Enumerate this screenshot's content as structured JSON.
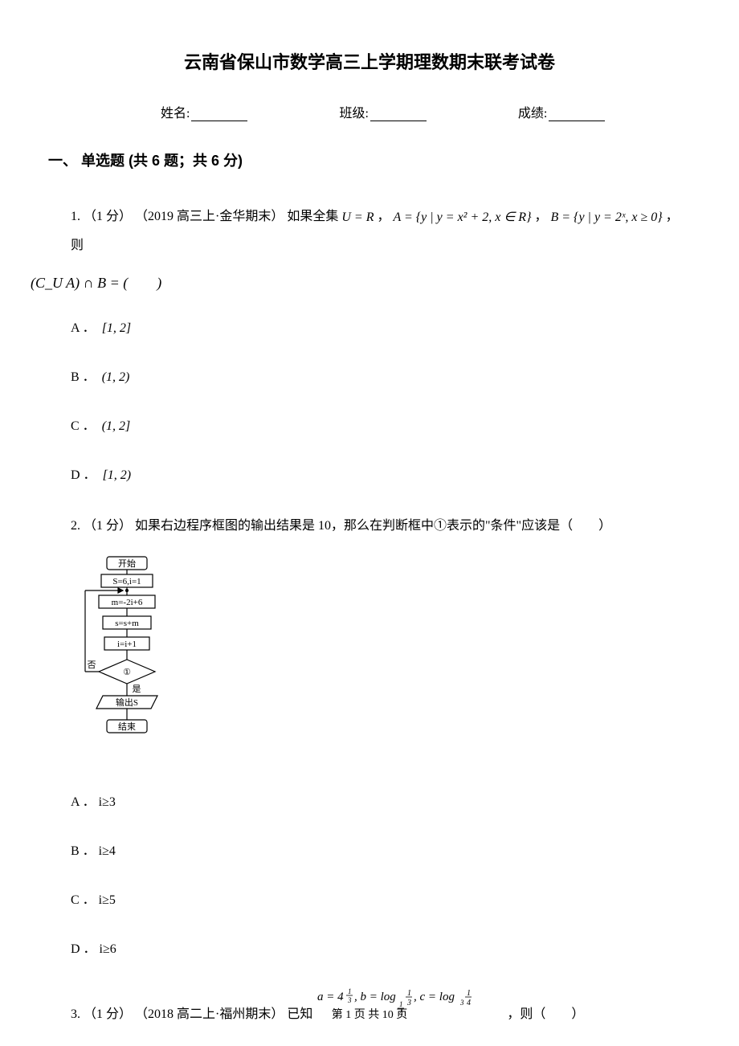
{
  "title": "云南省保山市数学高三上学期理数期末联考试卷",
  "header": {
    "name_label": "姓名:",
    "class_label": "班级:",
    "score_label": "成绩:"
  },
  "section1": {
    "heading": "一、 单选题 (共 6 题；共 6 分)"
  },
  "q1": {
    "stem_prefix": "1. （1 分） （2019 高三上·金华期末） 如果全集 ",
    "math1": "U = R",
    "sep1": " ， ",
    "math2": "A = {y | y = x² + 2, x ∈ R}",
    "sep2": " ， ",
    "math3": "B = {y | y = 2ˣ, x ≥ 0}",
    "sep3": " ，则",
    "line2_math": "(C_U A) ∩ B = (  )",
    "optA_label": "A ．",
    "optA_math": "[1, 2]",
    "optB_label": "B ．",
    "optB_math": "(1, 2)",
    "optC_label": "C ．",
    "optC_math": "(1, 2]",
    "optD_label": "D ．",
    "optD_math": "[1, 2)"
  },
  "q2": {
    "stem": "2. （1 分）  如果右边程序框图的输出结果是 10，那么在判断框中①表示的\"条件\"应该是（  ）",
    "flow": {
      "start": "开始",
      "init": "S=6,i=1",
      "step1": "m=-2i+6",
      "step2": "s=s+m",
      "step3": "i=i+1",
      "no": "否",
      "cond": "①",
      "yes": "是",
      "output": "输出S",
      "end": "结束"
    },
    "optA": "A ． i≥3",
    "optB": "B ． i≥4",
    "optC": "C ． i≥5",
    "optD": "D ． i≥6"
  },
  "q3": {
    "stem_prefix": "3. （1 分） （2018 高二上·福州期末） 已知 ",
    "math": "a = 4^{1/3}, b = log_{1/4}(1/3), c = log_{3}(1/4)",
    "stem_suffix": " ，则（  ）"
  },
  "footer": "第 1 页 共 10 页"
}
